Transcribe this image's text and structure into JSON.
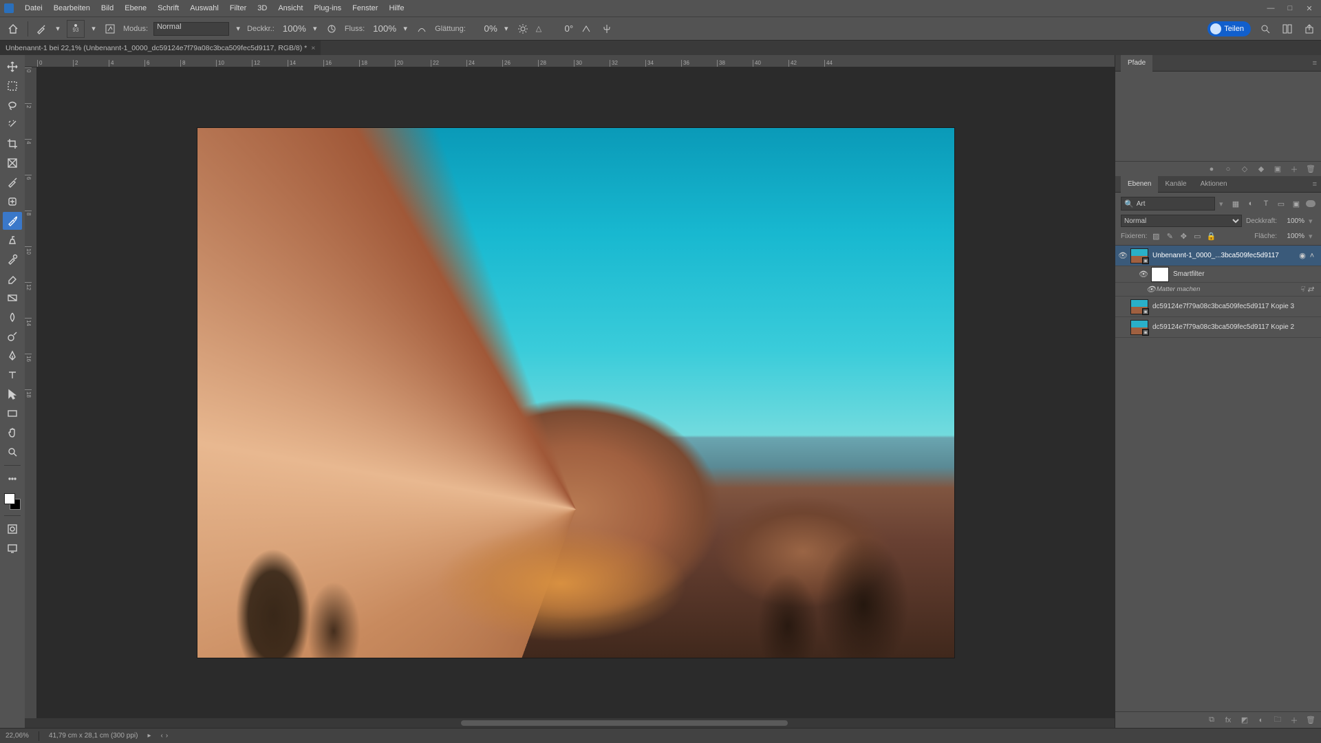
{
  "menu": {
    "items": [
      "Datei",
      "Bearbeiten",
      "Bild",
      "Ebene",
      "Schrift",
      "Auswahl",
      "Filter",
      "3D",
      "Ansicht",
      "Plug-ins",
      "Fenster",
      "Hilfe"
    ]
  },
  "options": {
    "brush_size": "93",
    "mode_label": "Modus:",
    "mode_value": "Normal",
    "opacity_label": "Deckkr.:",
    "opacity_value": "100%",
    "flow_label": "Fluss:",
    "flow_value": "100%",
    "smoothing_label": "Glättung:",
    "smoothing_value": "0%",
    "angle_icon": "△",
    "angle_value": "0°",
    "share_label": "Teilen"
  },
  "document": {
    "tab_title": "Unbenannt-1 bei 22,1% (Unbenannt-1_0000_dc59124e7f79a08c3bca509fec5d9117, RGB/8) *"
  },
  "ruler_h": [
    0,
    2,
    4,
    6,
    8,
    10,
    12,
    14,
    16,
    18,
    20,
    22,
    24,
    26,
    28,
    30,
    32,
    34,
    36,
    38,
    40,
    42,
    44
  ],
  "ruler_v": [
    0,
    2,
    4,
    6,
    8,
    10,
    12,
    14,
    16,
    18
  ],
  "panels": {
    "paths_tab": "Pfade",
    "layers_tabs": [
      "Ebenen",
      "Kanäle",
      "Aktionen"
    ],
    "search_kind": "Art",
    "blend_mode": "Normal",
    "opacity_label": "Deckkraft:",
    "opacity_value": "100%",
    "lock_label": "Fixieren:",
    "fill_label": "Fläche:",
    "fill_value": "100%"
  },
  "layers": [
    {
      "visible": true,
      "selected": true,
      "name": "Unbenannt-1_0000_...3bca509fec5d9117",
      "smart": true
    },
    {
      "sub": true,
      "visible": true,
      "name": "Smartfilter",
      "mask": true
    },
    {
      "sub2": true,
      "visible": true,
      "name": "Matter machen"
    },
    {
      "visible": false,
      "name": "dc59124e7f79a08c3bca509fec5d9117 Kopie 3",
      "smart": true
    },
    {
      "visible": false,
      "name": "dc59124e7f79a08c3bca509fec5d9117 Kopie 2",
      "smart": true
    }
  ],
  "status": {
    "zoom": "22,06%",
    "doc_size": "41,79 cm x 28,1 cm (300 ppi)"
  }
}
